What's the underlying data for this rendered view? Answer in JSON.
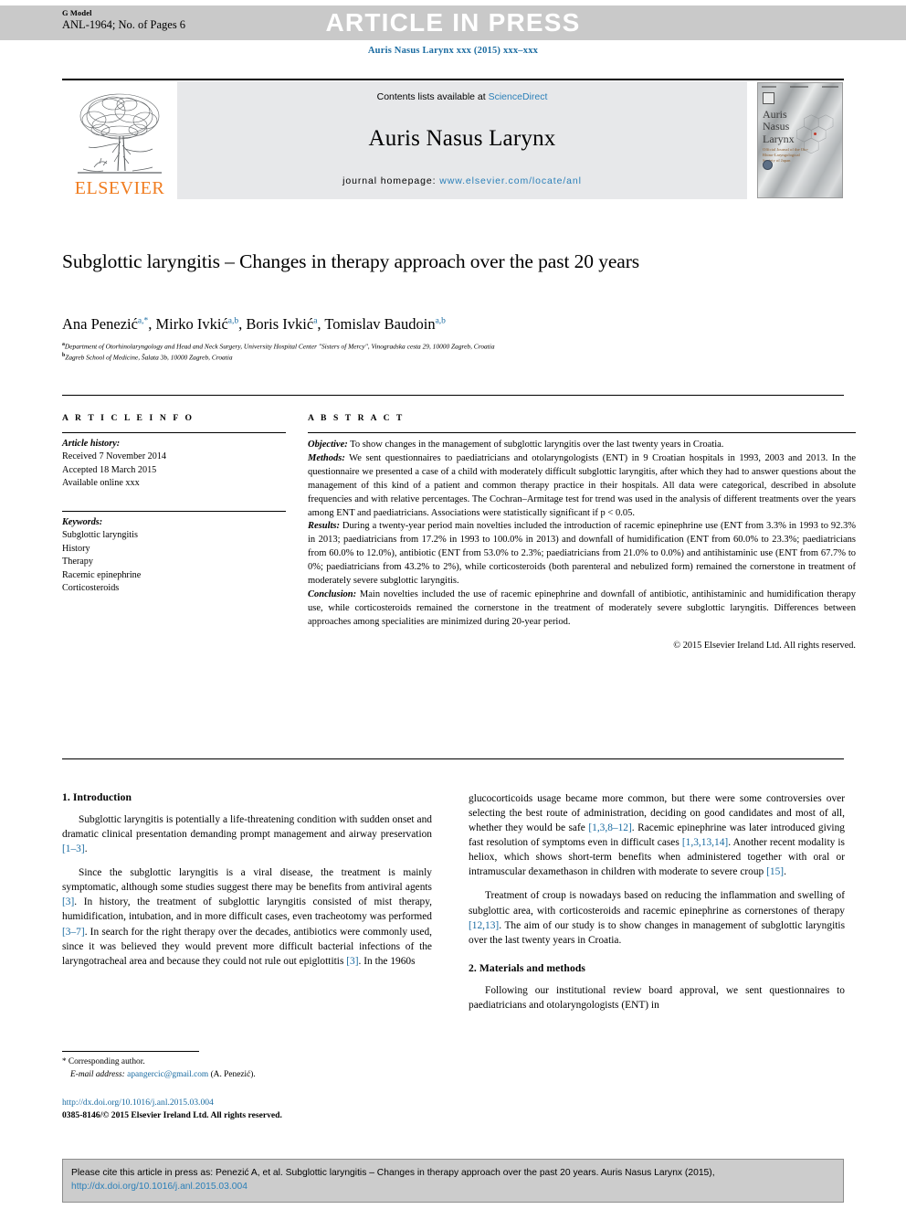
{
  "header": {
    "model_label": "G Model",
    "model_id": "ANL-1964; No. of Pages 6",
    "banner": "ARTICLE IN PRESS",
    "journal_ref": "Auris Nasus Larynx xxx (2015) xxx–xxx",
    "banner_bg": "#c9c9c9",
    "banner_text_color": "#ffffff"
  },
  "masthead": {
    "publisher": "ELSEVIER",
    "publisher_color": "#f07c1f",
    "contents_prefix": "Contents lists available at ",
    "contents_link": "ScienceDirect",
    "journal_name": "Auris Nasus Larynx",
    "homepage_prefix": "journal homepage: ",
    "homepage_url": "www.elsevier.com/locate/anl",
    "link_color": "#2a7fb8",
    "cover": {
      "line1": "Auris",
      "line2": "Nasus",
      "line3": "Larynx",
      "subtitle": "Official Journal of the Oto-Rhino-Laryngological Society of Japan"
    }
  },
  "article": {
    "title": "Subglottic laryngitis – Changes in therapy approach over the past 20 years",
    "authors": [
      {
        "name": "Ana Penezić",
        "marks": "a,",
        "star": "*",
        "sep": ", "
      },
      {
        "name": "Mirko Ivkić",
        "marks": "a,b",
        "star": "",
        "sep": ", "
      },
      {
        "name": "Boris Ivkić",
        "marks": "a",
        "star": "",
        "sep": ", "
      },
      {
        "name": "Tomislav Baudoin",
        "marks": "a,b",
        "star": "",
        "sep": ""
      }
    ],
    "affiliations": [
      {
        "mark": "a",
        "text": "Department of Otorhinolaryngology and Head and Neck Surgery, University Hospital Center \"Sisters of Mercy\", Vinogradska cesta 29, 10000 Zagreb, Croatia"
      },
      {
        "mark": "b",
        "text": "Zagreb School of Medicine, Šalata 3b, 10000 Zagreb, Croatia"
      }
    ]
  },
  "info": {
    "heading": "A R T I C L E   I N F O",
    "history_label": "Article history:",
    "history": [
      "Received 7 November 2014",
      "Accepted 18 March 2015",
      "Available online xxx"
    ],
    "keywords_label": "Keywords:",
    "keywords": [
      "Subglottic laryngitis",
      "History",
      "Therapy",
      "Racemic epinephrine",
      "Corticosteroids"
    ]
  },
  "abstract": {
    "heading": "A B S T R A C T",
    "sections": [
      {
        "label": "Objective:",
        "text": " To show changes in the management of subglottic laryngitis over the last twenty years in Croatia."
      },
      {
        "label": "Methods:",
        "text": " We sent questionnaires to paediatricians and otolaryngologists (ENT) in 9 Croatian hospitals in 1993, 2003 and 2013. In the questionnaire we presented a case of a child with moderately difficult subglottic laryngitis, after which they had to answer questions about the management of this kind of a patient and common therapy practice in their hospitals. All data were categorical, described in absolute frequencies and with relative percentages. The Cochran–Armitage test for trend was used in the analysis of different treatments over the years among ENT and paediatricians. Associations were statistically significant if p < 0.05."
      },
      {
        "label": "Results:",
        "text": " During a twenty-year period main novelties included the introduction of racemic epinephrine use (ENT from 3.3% in 1993 to 92.3% in 2013; paediatricians from 17.2% in 1993 to 100.0% in 2013) and downfall of humidification (ENT from 60.0% to 23.3%; paediatricians from 60.0% to 12.0%), antibiotic (ENT from 53.0% to 2.3%; paediatricians from 21.0% to 0.0%) and antihistaminic use (ENT from 67.7% to 0%; paediatricians from 43.2% to 2%), while corticosteroids (both parenteral and nebulized form) remained the cornerstone in treatment of moderately severe subglottic laryngitis."
      },
      {
        "label": "Conclusion:",
        "text": " Main novelties included the use of racemic epinephrine and downfall of antibiotic, antihistaminic and humidification therapy use, while corticosteroids remained the cornerstone in the treatment of moderately severe subglottic laryngitis. Differences between approaches among specialities are minimized during 20-year period."
      }
    ],
    "copyright": "© 2015 Elsevier Ireland Ltd. All rights reserved."
  },
  "sections": {
    "intro_heading": "1. Introduction",
    "methods_heading": "2. Materials and methods",
    "left_paragraphs": [
      {
        "parts": [
          {
            "t": "Subglottic laryngitis is potentially a life-threatening condition with sudden onset and dramatic clinical presentation demanding prompt management and airway preservation ",
            "k": "plain"
          },
          {
            "t": "[1–3]",
            "k": "ref"
          },
          {
            "t": ".",
            "k": "plain"
          }
        ]
      },
      {
        "parts": [
          {
            "t": "Since the subglottic laryngitis is a viral disease, the treatment is mainly symptomatic, although some studies suggest there may be benefits from antiviral agents ",
            "k": "plain"
          },
          {
            "t": "[3]",
            "k": "ref"
          },
          {
            "t": ". In history, the treatment of subglottic laryngitis consisted of mist therapy, humidification, intubation, and in more difficult cases, even tracheotomy was performed ",
            "k": "plain"
          },
          {
            "t": "[3–7]",
            "k": "ref"
          },
          {
            "t": ". In search for the right therapy over the decades, antibiotics were commonly used, since it was believed they would prevent more difficult bacterial infections of the laryngotracheal area and because they could not rule out epiglottitis ",
            "k": "plain"
          },
          {
            "t": "[3]",
            "k": "ref"
          },
          {
            "t": ". In the 1960s",
            "k": "plain"
          }
        ]
      }
    ],
    "right_paragraphs": [
      {
        "indent": false,
        "parts": [
          {
            "t": "glucocorticoids usage became more common, but there were some controversies over selecting the best route of administration, deciding on good candidates and most of all, whether they would be safe ",
            "k": "plain"
          },
          {
            "t": "[1,3,8–12]",
            "k": "ref"
          },
          {
            "t": ". Racemic epinephrine was later introduced giving fast resolution of symptoms even in difficult cases ",
            "k": "plain"
          },
          {
            "t": "[1,3,13,14]",
            "k": "ref"
          },
          {
            "t": ". Another recent modality is heliox, which shows short-term benefits when administered together with oral or intramuscular dexamethason in children with moderate to severe croup ",
            "k": "plain"
          },
          {
            "t": "[15]",
            "k": "ref"
          },
          {
            "t": ".",
            "k": "plain"
          }
        ]
      },
      {
        "indent": true,
        "parts": [
          {
            "t": "Treatment of croup is nowadays based on reducing the inflammation and swelling of subglottic area, with corticosteroids and racemic epinephrine as cornerstones of therapy ",
            "k": "plain"
          },
          {
            "t": "[12,13]",
            "k": "ref"
          },
          {
            "t": ". The aim of our study is to show changes in management of subglottic laryngitis over the last twenty years in Croatia.",
            "k": "plain"
          }
        ]
      }
    ],
    "methods_paragraph": {
      "indent": true,
      "parts": [
        {
          "t": "Following our institutional review board approval, we sent questionnaires to paediatricians and otolaryngologists (ENT) in",
          "k": "plain"
        }
      ]
    }
  },
  "footnote": {
    "star": "*",
    "corresponding": " Corresponding author.",
    "email_label": "E-mail address:",
    "email": "apangercic@gmail.com",
    "email_attrib": " (A. Penezić).",
    "doi": "http://dx.doi.org/10.1016/j.anl.2015.03.004",
    "issn_line": "0385-8146/© 2015 Elsevier Ireland Ltd. All rights reserved."
  },
  "cite_box": {
    "text_before": "Please cite this article in press as: Penezić A, et al. Subglottic laryngitis – Changes in therapy approach over the past 20 years. Auris Nasus Larynx (2015), ",
    "doi": "http://dx.doi.org/10.1016/j.anl.2015.03.004"
  }
}
